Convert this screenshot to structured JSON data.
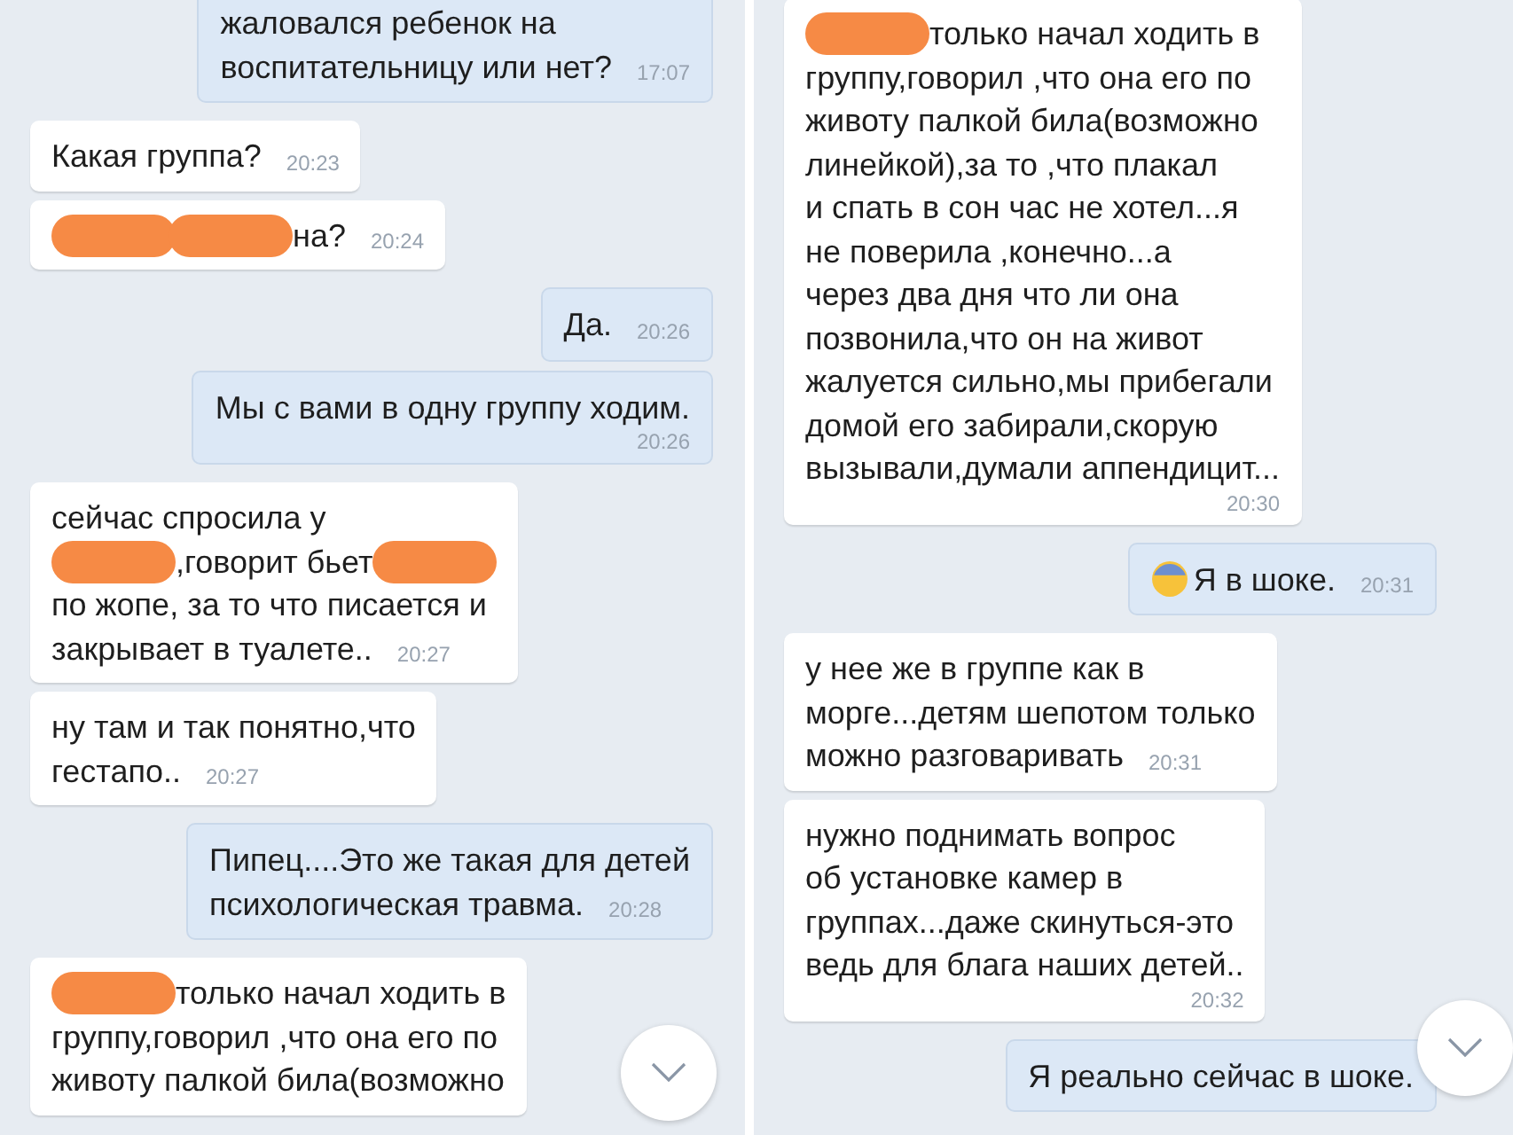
{
  "panels": [
    {
      "messages": [
        {
          "kind": "outgoing",
          "time": "17:07",
          "time_below": false,
          "lines": [
            [
              {
                "kind": "text",
                "text": "жаловался ребенок на"
              }
            ],
            [
              {
                "kind": "text",
                "text": "воспитательницу или нет?"
              }
            ]
          ]
        },
        {
          "kind": "incoming",
          "time": "20:23",
          "time_below": false,
          "lines": [
            [
              {
                "kind": "text",
                "text": "Какая группа?"
              }
            ]
          ]
        },
        {
          "kind": "incoming",
          "time": "20:24",
          "time_below": false,
          "lines": [
            [
              {
                "kind": "redaction"
              },
              {
                "kind": "redaction"
              },
              {
                "kind": "text",
                "text": "на?"
              }
            ]
          ]
        },
        {
          "kind": "outgoing",
          "time": "20:26",
          "time_below": false,
          "lines": [
            [
              {
                "kind": "text",
                "text": "Да."
              }
            ]
          ]
        },
        {
          "kind": "outgoing",
          "time": "20:26",
          "time_below": true,
          "lines": [
            [
              {
                "kind": "text",
                "text": "Мы с вами в одну группу ходим."
              }
            ]
          ]
        },
        {
          "kind": "incoming",
          "time": "20:27",
          "time_below": false,
          "lines": [
            [
              {
                "kind": "text",
                "text": "сейчас спросила у"
              }
            ],
            [
              {
                "kind": "redaction"
              },
              {
                "kind": "text",
                "text": ",говорит бьет"
              },
              {
                "kind": "redaction"
              }
            ],
            [
              {
                "kind": "text",
                "text": "по жопе, за то что писается и"
              }
            ],
            [
              {
                "kind": "text",
                "text": "закрывает в туалете.."
              }
            ]
          ]
        },
        {
          "kind": "incoming",
          "time": "20:27",
          "time_below": false,
          "lines": [
            [
              {
                "kind": "text",
                "text": "ну там и так понятно,что"
              }
            ],
            [
              {
                "kind": "text",
                "text": "гестапо.."
              }
            ]
          ]
        },
        {
          "kind": "outgoing",
          "time": "20:28",
          "time_below": false,
          "lines": [
            [
              {
                "kind": "text",
                "text": "Пипец....Это же такая для детей"
              }
            ],
            [
              {
                "kind": "text",
                "text": "психологическая травма."
              }
            ]
          ]
        },
        {
          "kind": "incoming",
          "lines": [
            [
              {
                "kind": "redaction"
              },
              {
                "kind": "text",
                "text": "только начал ходить в"
              }
            ],
            [
              {
                "kind": "text",
                "text": "группу,говорил ,что она его по"
              }
            ],
            [
              {
                "kind": "text",
                "text": "животу палкой била(возможно"
              }
            ]
          ]
        }
      ]
    },
    {
      "messages": [
        {
          "kind": "incoming",
          "time": "20:30",
          "time_below": true,
          "lines": [
            [
              {
                "kind": "redaction"
              },
              {
                "kind": "text",
                "text": "только начал ходить в"
              }
            ],
            [
              {
                "kind": "text",
                "text": "группу,говорил ,что она его по"
              }
            ],
            [
              {
                "kind": "text",
                "text": "животу палкой била(возможно"
              }
            ],
            [
              {
                "kind": "text",
                "text": "линейкой),за то ,что плакал"
              }
            ],
            [
              {
                "kind": "text",
                "text": "и спать в сон час не хотел...я"
              }
            ],
            [
              {
                "kind": "text",
                "text": "не поверила ,конечно...а"
              }
            ],
            [
              {
                "kind": "text",
                "text": "через два дня что ли она"
              }
            ],
            [
              {
                "kind": "text",
                "text": "позвонила,что он на живот"
              }
            ],
            [
              {
                "kind": "text",
                "text": "жалуется сильно,мы прибегали"
              }
            ],
            [
              {
                "kind": "text",
                "text": "домой его забирали,скорую"
              }
            ],
            [
              {
                "kind": "text",
                "text": "вызывали,думали аппендицит..."
              }
            ]
          ]
        },
        {
          "kind": "outgoing",
          "time": "20:31",
          "time_below": false,
          "lines": [
            [
              {
                "kind": "emoji"
              },
              {
                "kind": "text",
                "text": "Я в шоке."
              }
            ]
          ]
        },
        {
          "kind": "incoming",
          "time": "20:31",
          "time_below": false,
          "lines": [
            [
              {
                "kind": "text",
                "text": "у нее же в группе как в"
              }
            ],
            [
              {
                "kind": "text",
                "text": "морге...детям шепотом только"
              }
            ],
            [
              {
                "kind": "text",
                "text": "можно разговаривать"
              }
            ]
          ]
        },
        {
          "kind": "incoming",
          "time": "20:32",
          "time_below": true,
          "lines": [
            [
              {
                "kind": "text",
                "text": "нужно поднимать вопрос"
              }
            ],
            [
              {
                "kind": "text",
                "text": "об установке камер в"
              }
            ],
            [
              {
                "kind": "text",
                "text": "группах...даже скинуться-это"
              }
            ],
            [
              {
                "kind": "text",
                "text": "ведь для блага наших детей.."
              }
            ]
          ]
        },
        {
          "kind": "outgoing",
          "lines": [
            [
              {
                "kind": "text",
                "text": "Я реально сейчас в шоке."
              }
            ]
          ]
        }
      ]
    }
  ]
}
